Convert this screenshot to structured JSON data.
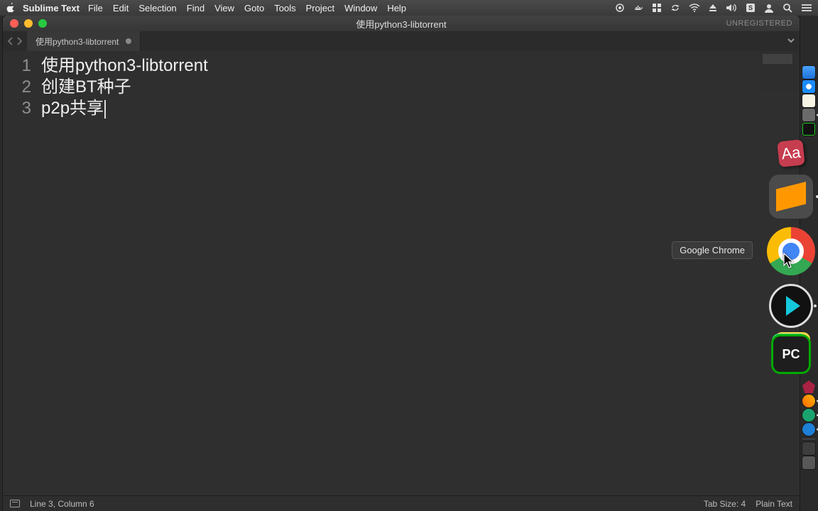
{
  "menubar": {
    "app_name": "Sublime Text",
    "items": [
      "File",
      "Edit",
      "Selection",
      "Find",
      "View",
      "Goto",
      "Tools",
      "Project",
      "Window",
      "Help"
    ]
  },
  "window": {
    "title": "使用python3-libtorrent",
    "unregistered": "UNREGISTERED",
    "tab_label": "使用python3-libtorrent"
  },
  "editor": {
    "gutter": [
      "1",
      "2",
      "3"
    ],
    "lines": [
      "使用python3-libtorrent",
      "创建BT种子",
      "p2p共享"
    ]
  },
  "statusbar": {
    "position": "Line 3, Column 6",
    "tab_size": "Tab Size: 4",
    "syntax": "Plain Text"
  },
  "dock": {
    "tooltip": "Google Chrome",
    "dict_glyph": "Aa",
    "pycharm_glyph": "PC"
  }
}
